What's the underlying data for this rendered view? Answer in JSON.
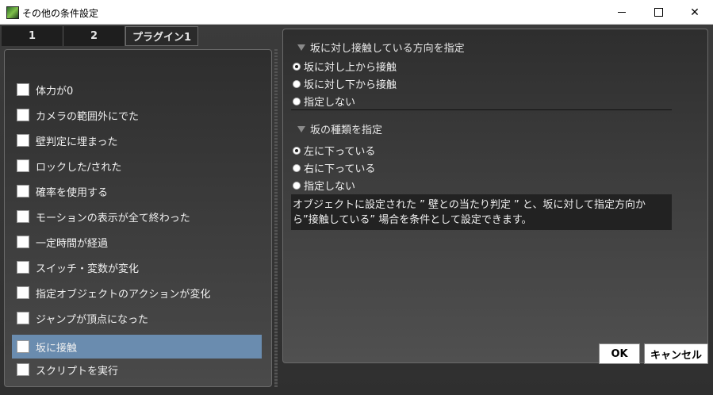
{
  "window": {
    "title": "その他の条件設定",
    "close_glyph": "✕"
  },
  "tabs": [
    {
      "label": "1"
    },
    {
      "label": "2"
    },
    {
      "label": "プラグイン1"
    }
  ],
  "conditions": [
    {
      "label": "体力が0",
      "checked": false
    },
    {
      "label": "カメラの範囲外にでた",
      "checked": false
    },
    {
      "label": "壁判定に埋まった",
      "checked": false
    },
    {
      "label": "ロックした/された",
      "checked": false
    },
    {
      "label": "確率を使用する",
      "checked": false
    },
    {
      "label": "モーションの表示が全て終わった",
      "checked": false
    },
    {
      "label": "一定時間が経過",
      "checked": false
    },
    {
      "label": "スイッチ・変数が変化",
      "checked": false
    },
    {
      "label": "指定オブジェクトのアクションが変化",
      "checked": false
    },
    {
      "label": "ジャンプが頂点になった",
      "checked": false
    },
    {
      "label": "坂に接触",
      "checked": false,
      "selected": true
    },
    {
      "label": "スクリプトを実行",
      "checked": false
    }
  ],
  "contact_direction": {
    "heading": "坂に対し接触している方向を指定",
    "options": [
      {
        "label": "坂に対し上から接触",
        "selected": true
      },
      {
        "label": "坂に対し下から接触",
        "selected": false
      },
      {
        "label": "指定しない",
        "selected": false
      }
    ]
  },
  "slope_type": {
    "heading": "坂の種類を指定",
    "options": [
      {
        "label": "左に下っている",
        "selected": true
      },
      {
        "label": "右に下っている",
        "selected": false
      },
      {
        "label": "指定しない",
        "selected": false
      }
    ]
  },
  "description": {
    "line1": "オブジェクトに設定された ” 壁との当たり判定 ” と、坂に対して指定方向か",
    "line2": "ら”接触している” 場合を条件として設定できます。"
  },
  "buttons": {
    "ok": "OK",
    "cancel": "キャンセル"
  },
  "colors": {
    "selected_row": "#6a8caf",
    "panel_dark": "#2e2e2e"
  }
}
